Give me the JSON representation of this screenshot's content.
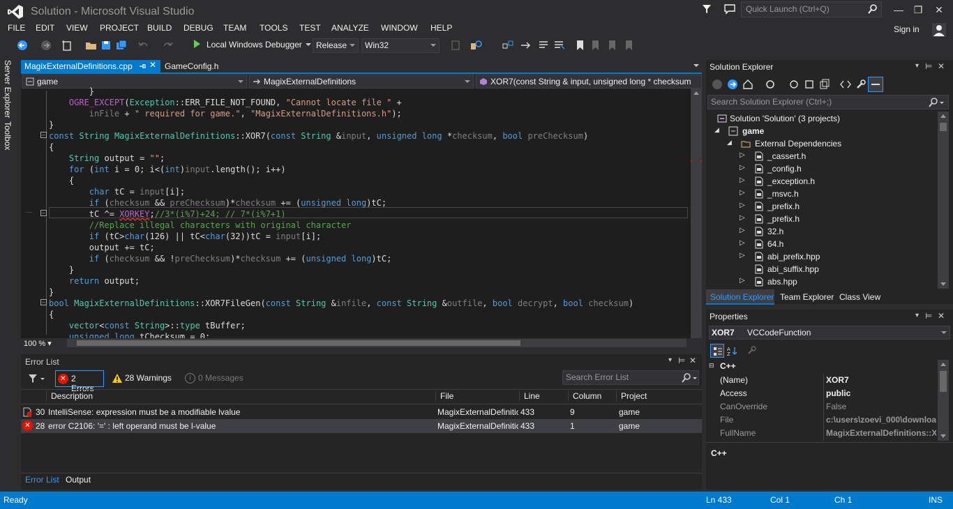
{
  "titlebar": {
    "title": "Solution - Microsoft Visual Studio",
    "quick_launch_placeholder": "Quick Launch (Ctrl+Q)",
    "sign_in": "Sign in"
  },
  "menu": [
    "FILE",
    "EDIT",
    "VIEW",
    "PROJECT",
    "BUILD",
    "DEBUG",
    "TEAM",
    "TOOLS",
    "TEST",
    "ANALYZE",
    "WINDOW",
    "HELP"
  ],
  "toolbar": {
    "debugger": "Local Windows Debugger",
    "configuration": "Release",
    "platform": "Win32"
  },
  "left_tabs": [
    "Server Explorer",
    "Toolbox"
  ],
  "doc_tabs": {
    "active": "MagixExternalDefinitions.cpp",
    "second": "GameConfig.h"
  },
  "navbar": {
    "project": "game",
    "scope": "MagixExternalDefinitions",
    "member": "XOR7(const String & input, unsigned long * checksum"
  },
  "editor": {
    "zoom": "100 %"
  },
  "error_list": {
    "title": "Error List",
    "errors_label": "2 Errors",
    "warnings_label": "28 Warnings",
    "messages_label": "0 Messages",
    "search_placeholder": "Search Error List",
    "columns": [
      "Description",
      "File",
      "Line",
      "Column",
      "Project"
    ],
    "rows": [
      {
        "num": "30",
        "desc": "IntelliSense: expression must be a modifiable lvalue",
        "file": "MagixExternalDefinitic",
        "line": "433",
        "col": "9",
        "project": "game"
      },
      {
        "num": "28",
        "desc": "error C2106: '=' : left operand must be l-value",
        "file": "MagixExternalDefinitic",
        "line": "433",
        "col": "1",
        "project": "game"
      }
    ],
    "tabs": [
      "Error List",
      "Output"
    ]
  },
  "solution_explorer": {
    "title": "Solution Explorer",
    "search_placeholder": "Search Solution Explorer (Ctrl+;)",
    "solution": "Solution 'Solution' (3 projects)",
    "project": "game",
    "folder": "External Dependencies",
    "files": [
      "_cassert.h",
      "_config.h",
      "_exception.h",
      "_msvc.h",
      "_prefix.h",
      "_prefix.h",
      "32.h",
      "64.h",
      "abi_prefix.hpp",
      "abi_suffix.hpp",
      "abs.hpp"
    ],
    "tabs": [
      "Solution Explorer",
      "Team Explorer",
      "Class View"
    ]
  },
  "properties": {
    "title": "Properties",
    "object_name": "XOR7",
    "object_type": "VCCodeFunction",
    "category": "C++",
    "rows": [
      {
        "name": "(Name)",
        "value": "XOR7"
      },
      {
        "name": "Access",
        "value": "public"
      },
      {
        "name": "CanOverride",
        "value": "False"
      },
      {
        "name": "File",
        "value": "c:\\users\\zoevi_000\\downloa"
      },
      {
        "name": "FullName",
        "value": "MagixExternalDefinitions::X("
      }
    ],
    "description": "C++"
  },
  "statusbar": {
    "state": "Ready",
    "line": "Ln 433",
    "col": "Col 1",
    "ch": "Ch 1",
    "mode": "INS"
  },
  "colors": {
    "accent": "#007acc",
    "error": "#e51400",
    "warning": "#ffcc00"
  }
}
